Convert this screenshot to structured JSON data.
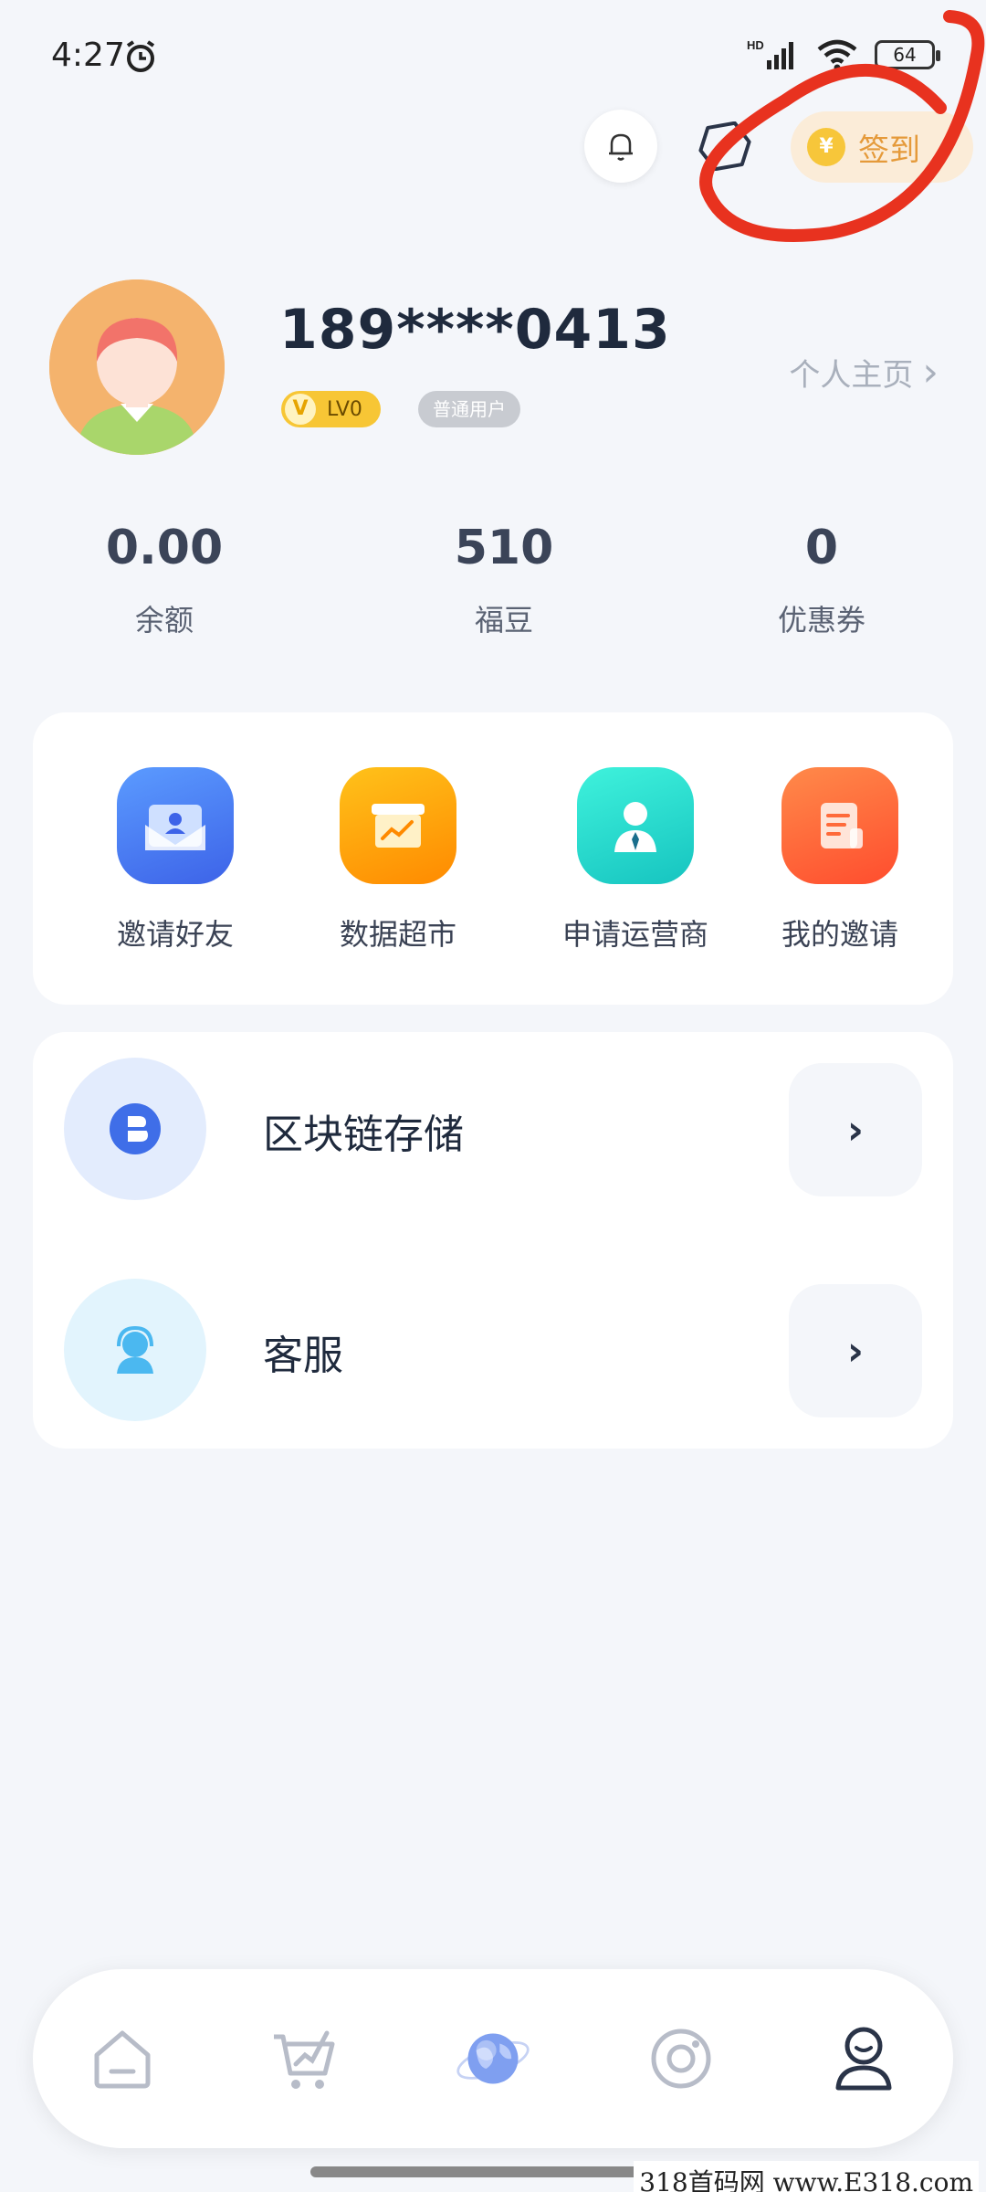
{
  "status_bar": {
    "time": "4:27",
    "network": "HD",
    "battery": "64"
  },
  "header": {
    "checkin_label": "签到",
    "coin_symbol": "¥"
  },
  "profile": {
    "phone": "189****0413",
    "level_letter": "V",
    "level": "LV0",
    "user_type": "普通用户",
    "homepage_label": "个人主页",
    "homepage_arrow": "›"
  },
  "stats": [
    {
      "value": "0.00",
      "label": "余额"
    },
    {
      "value": "510",
      "label": "福豆"
    },
    {
      "value": "0",
      "label": "优惠券"
    }
  ],
  "shortcuts": [
    {
      "label": "邀请好友",
      "icon": "invite-card-icon",
      "color": "#4a7df5"
    },
    {
      "label": "数据超市",
      "icon": "chart-box-icon",
      "color": "#ffa21a"
    },
    {
      "label": "申请运营商",
      "icon": "operator-person-icon",
      "color": "#22d3c8"
    },
    {
      "label": "我的邀请",
      "icon": "document-icon",
      "color": "#ff6a3a"
    }
  ],
  "list": [
    {
      "label": "区块链存储",
      "icon": "blockchain-icon",
      "arrow": "›"
    },
    {
      "label": "客服",
      "icon": "customer-service-icon",
      "arrow": "›"
    }
  ],
  "bottom_nav": [
    {
      "icon": "home-icon"
    },
    {
      "icon": "cart-icon"
    },
    {
      "icon": "globe-icon"
    },
    {
      "icon": "discover-icon"
    },
    {
      "icon": "profile-icon",
      "active": true
    }
  ],
  "watermark": "318首码网 www.E318.com"
}
